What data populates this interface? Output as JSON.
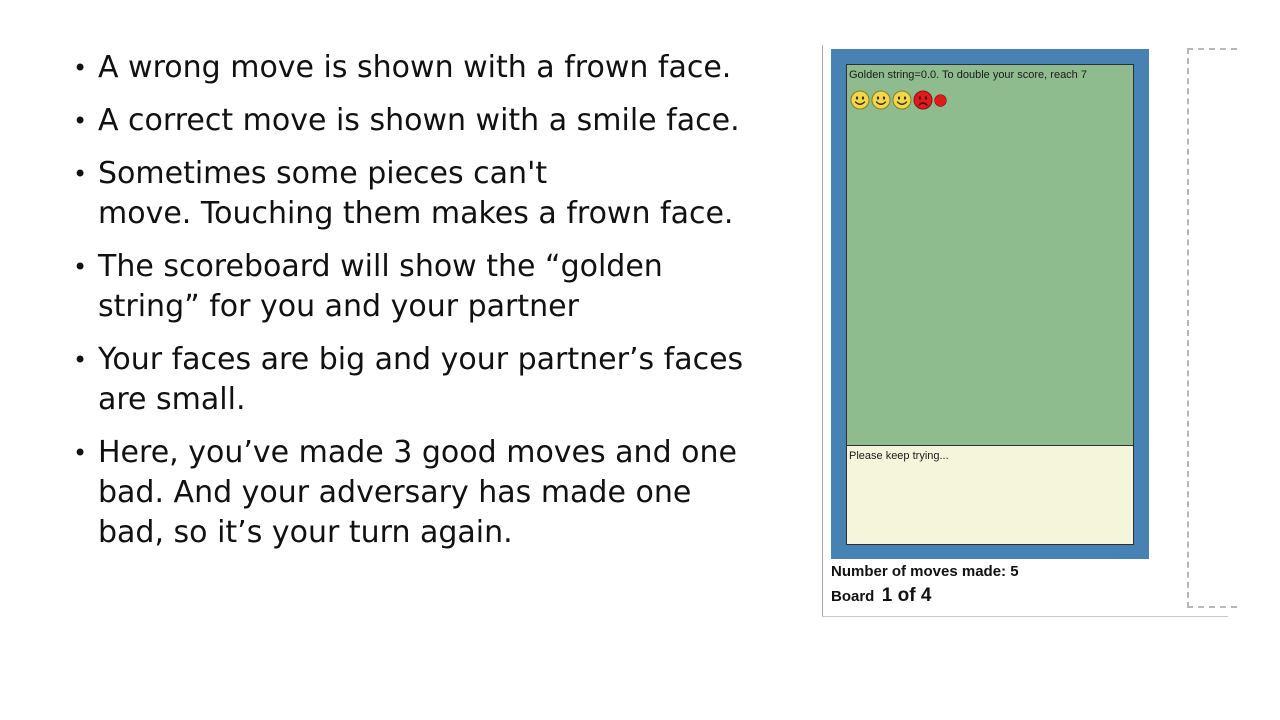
{
  "bullets": [
    "A wrong move is shown with a frown face.",
    "A correct move is shown with a smile face.",
    " Sometimes some pieces can't\nmove. Touching them makes a frown face.",
    "The scoreboard will show the “golden\nstring”  for you and your partner",
    "Your faces are big and your partner’s faces\nare small.",
    "Here, you’ve made 3 good moves and one\nbad. And your adversary has made one\nbad, so it’s your turn again."
  ],
  "game": {
    "score_text": "Golden string=0.0. To double your score, reach 7",
    "faces": [
      {
        "icon": "smile-face-icon",
        "size": "big",
        "color": "#f2d64b"
      },
      {
        "icon": "smile-face-icon",
        "size": "big",
        "color": "#f2d64b"
      },
      {
        "icon": "smile-face-icon",
        "size": "big",
        "color": "#f2d64b"
      },
      {
        "icon": "frown-face-icon",
        "size": "big",
        "color": "#e01b1b"
      },
      {
        "icon": "frown-face-icon",
        "size": "small",
        "color": "#e01b1b"
      }
    ],
    "message": "Please keep trying...",
    "moves_label": "Number of moves made: 5",
    "board_label": "Board",
    "board_value": "1 of 4"
  },
  "colors": {
    "board_frame": "#4682b4",
    "play_area": "#8fbc8f",
    "message_area": "#f5f5dc"
  }
}
